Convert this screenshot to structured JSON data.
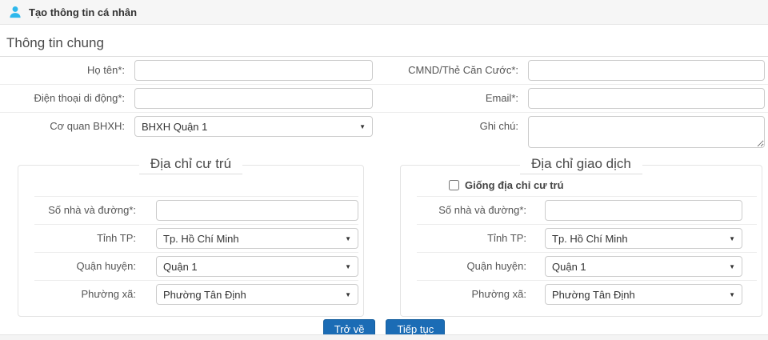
{
  "header": {
    "title": "Tạo thông tin cá nhân"
  },
  "general": {
    "title": "Thông tin chung",
    "ho_ten": {
      "label": "Họ tên*:",
      "value": ""
    },
    "cmnd": {
      "label": "CMND/Thẻ Căn Cước*:",
      "value": ""
    },
    "dien_thoai": {
      "label": "Điện thoại di động*:",
      "value": ""
    },
    "email": {
      "label": "Email*:",
      "value": ""
    },
    "co_quan": {
      "label": "Cơ quan BHXH:",
      "value": "BHXH Quận 1"
    },
    "ghi_chu": {
      "label": "Ghi chú:",
      "value": ""
    }
  },
  "residence_address": {
    "title": "Địa chỉ cư trú",
    "street": {
      "label": "Số nhà và đường*:",
      "value": ""
    },
    "province": {
      "label": "Tỉnh TP:",
      "value": "Tp. Hồ Chí Minh"
    },
    "district": {
      "label": "Quận huyện:",
      "value": "Quận 1"
    },
    "ward": {
      "label": "Phường xã:",
      "value": "Phường Tân Định"
    }
  },
  "transaction_address": {
    "title": "Địa chỉ giao dịch",
    "same_as_residence_label": "Giống địa chỉ cư trú",
    "same_as_residence_checked": false,
    "street": {
      "label": "Số nhà và đường*:",
      "value": ""
    },
    "province": {
      "label": "Tỉnh TP:",
      "value": "Tp. Hồ Chí Minh"
    },
    "district": {
      "label": "Quận huyện:",
      "value": "Quận 1"
    },
    "ward": {
      "label": "Phường xã:",
      "value": "Phường Tân Định"
    }
  },
  "actions": {
    "back": "Trở về",
    "continue": "Tiếp tục"
  },
  "colors": {
    "primary_button": "#1b6cb5",
    "user_icon": "#2eb8ec"
  }
}
